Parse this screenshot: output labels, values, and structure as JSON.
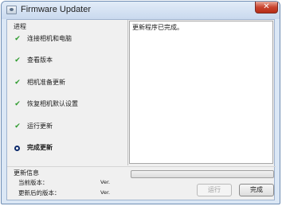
{
  "window": {
    "title": "Firmware Updater",
    "close_glyph": "✕"
  },
  "steps_panel": {
    "heading": "进程",
    "items": [
      {
        "label": "连接相机和电脑",
        "status": "done",
        "icon": "check-icon",
        "glyph": "✔"
      },
      {
        "label": "查看版本",
        "status": "done",
        "icon": "check-icon",
        "glyph": "✔"
      },
      {
        "label": "相机准备更新",
        "status": "done",
        "icon": "check-icon",
        "glyph": "✔"
      },
      {
        "label": "恢复相机默认设置",
        "status": "done",
        "icon": "check-icon",
        "glyph": "✔"
      },
      {
        "label": "运行更新",
        "status": "done",
        "icon": "check-icon",
        "glyph": "✔"
      },
      {
        "label": "完成更新",
        "status": "current",
        "icon": "current-step-icon",
        "glyph": ""
      }
    ]
  },
  "log": {
    "text": "更新程序已完成。"
  },
  "update_info": {
    "heading": "更新信息",
    "current_version_label": "当前版本：",
    "current_version_value": "Ver.",
    "updated_version_label": "更新后的版本：",
    "updated_version_value": "Ver."
  },
  "progress": {
    "percent": 0
  },
  "buttons": {
    "run_label": "运行",
    "run_enabled": false,
    "finish_label": "完成"
  },
  "colors": {
    "check": "#2e9b2e",
    "current_step": "#0c2a6b",
    "close_button": "#c9442f"
  }
}
